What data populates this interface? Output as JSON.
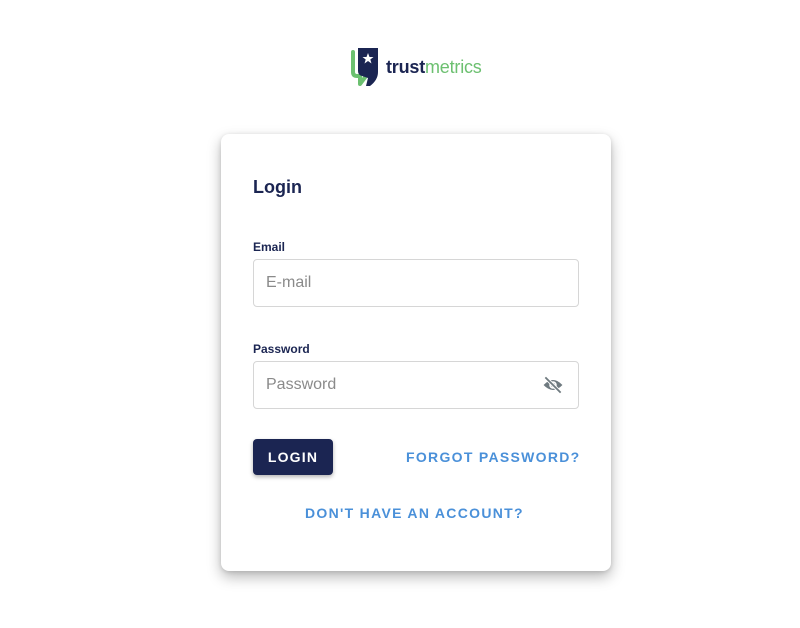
{
  "brand": {
    "name_bold": "trust",
    "name_light": "metrics",
    "logo_icon": "shield-star-logo-icon",
    "colors": {
      "navy": "#1b2552",
      "green": "#6cc070",
      "link_blue": "#4a90d9"
    }
  },
  "login": {
    "title": "Login",
    "email": {
      "label": "Email",
      "placeholder": "E-mail",
      "value": ""
    },
    "password": {
      "label": "Password",
      "placeholder": "Password",
      "value": "",
      "toggle_icon": "eye-off-icon"
    },
    "submit_label": "LOGIN",
    "forgot_label": "FORGOT PASSWORD?",
    "signup_label": "DON'T HAVE AN ACCOUNT?"
  }
}
